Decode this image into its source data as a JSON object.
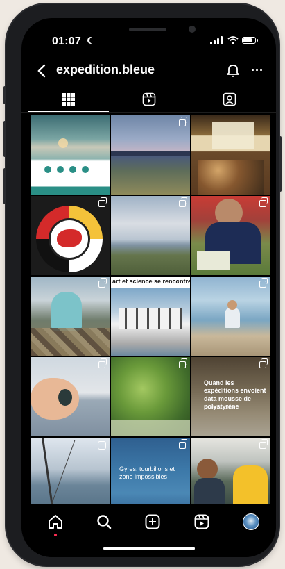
{
  "status_bar": {
    "time": "01:07"
  },
  "header": {
    "username": "expedition.bleue",
    "more_label": "···"
  },
  "tabs": [
    {
      "name": "posts",
      "icon": "grid-icon",
      "active": true
    },
    {
      "name": "reels",
      "icon": "reels-icon",
      "active": false
    },
    {
      "name": "tagged",
      "icon": "tagged-icon",
      "active": false
    }
  ],
  "posts": [
    {
      "id": 1,
      "description": "infographic with sea and circles",
      "multi": false
    },
    {
      "id": 2,
      "description": "sunset over water",
      "multi": true
    },
    {
      "id": 3,
      "description": "presentation event crowd",
      "multi": false
    },
    {
      "id": 4,
      "description": "beaded medallion logo",
      "multi": true
    },
    {
      "id": 5,
      "description": "cloudy shoreline",
      "multi": true
    },
    {
      "id": 6,
      "description": "person writing on grass",
      "multi": true
    },
    {
      "id": 7,
      "description": "researcher on rocky beach",
      "multi": true
    },
    {
      "id": 8,
      "description": "group on boat",
      "multi": true,
      "overlay_text": "art et science se rencontrent"
    },
    {
      "id": 9,
      "description": "person sitting on beach",
      "multi": true
    },
    {
      "id": 10,
      "description": "hand holding stone",
      "multi": true
    },
    {
      "id": 11,
      "description": "green seaweed underwater",
      "multi": true
    },
    {
      "id": 12,
      "description": "beach debris",
      "multi": true,
      "overlay_text": "Quand les expéditions envoient data mousse de polystyrène",
      "small_text": "Expédition Bleue"
    },
    {
      "id": 13,
      "description": "sailboat rigging",
      "reel": true
    },
    {
      "id": 14,
      "description": "blue water text",
      "multi": true,
      "overlay_text": "Gyres, tourbillons et zone impossibles"
    },
    {
      "id": 15,
      "description": "people working in boat cabin",
      "multi": true
    }
  ],
  "colors": {
    "background": "#000000",
    "accent_notification": "#ff2e53"
  },
  "bottom_nav": [
    "home-icon",
    "search-icon",
    "create-icon",
    "reels-icon",
    "profile-avatar"
  ]
}
